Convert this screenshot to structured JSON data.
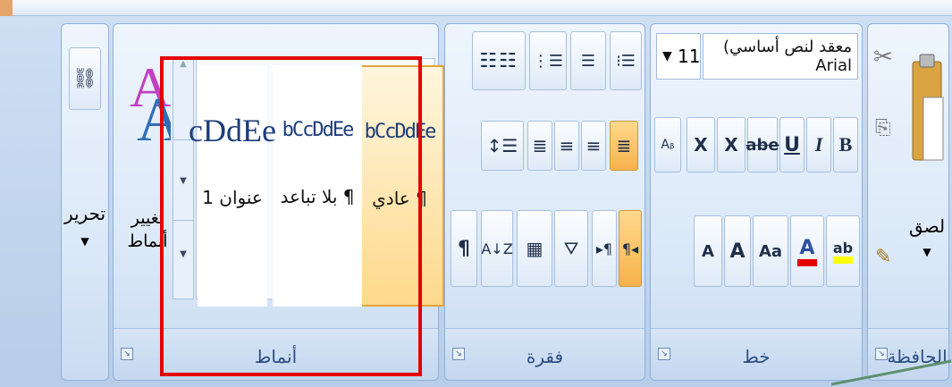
{
  "ribbon": {
    "groups": {
      "clipboard": {
        "label": "الحافظة",
        "paste_label": "لصق"
      },
      "font": {
        "label": "خط",
        "font_name": "معقد لنص أساسي) Arial",
        "font_size": "11",
        "bold": "B",
        "italic": "I",
        "underline": "U",
        "strikethrough": "abe",
        "subscript": "X",
        "superscript": "X",
        "change_case": "Aa",
        "grow_font": "A",
        "shrink_font": "A",
        "font_color": "A",
        "highlight": "ab",
        "highlight_color": "#ffff00",
        "font_color_bar": "#e60000"
      },
      "paragraph": {
        "label": "فقرة",
        "pilcrow": "¶"
      },
      "styles": {
        "label": "أنماط",
        "change_styles_label": "تغيير أنماط",
        "items": [
          {
            "preview": "bCcDdEe",
            "name": "¶ عادي",
            "selected": true
          },
          {
            "preview": "bCcDdEe",
            "name": "¶ بلا تباعد",
            "selected": false
          },
          {
            "preview": "cDdEe",
            "name": "عنوان 1",
            "selected": false
          }
        ]
      },
      "editing": {
        "label": "تحرير"
      }
    }
  }
}
